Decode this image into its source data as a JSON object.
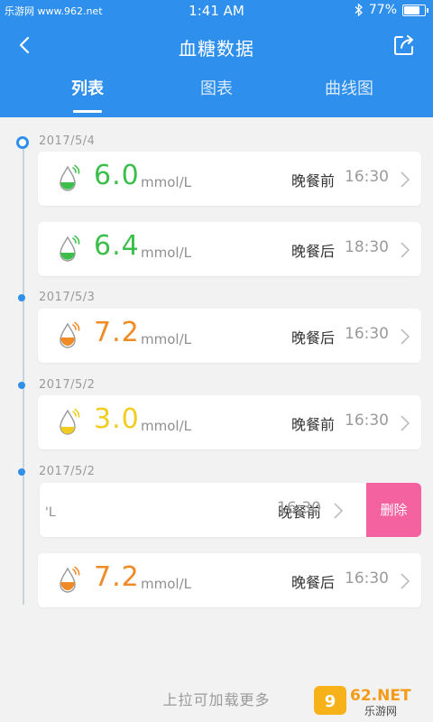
{
  "status": {
    "site": "乐游网 www.962.net",
    "time": "1:41 AM",
    "battery": "77%",
    "battery_level": 0.77
  },
  "header": {
    "title": "血糖数据",
    "tabs": [
      {
        "label": "列表",
        "active": true
      },
      {
        "label": "图表",
        "active": false
      },
      {
        "label": "曲线图",
        "active": false
      }
    ]
  },
  "groups": [
    {
      "date": "2017/5/4",
      "records": [
        {
          "value": "6.0",
          "unit": "mmol/L",
          "meal": "晚餐前",
          "time": "16:30",
          "color": "#3cbf4a",
          "level": "normal"
        },
        {
          "value": "6.4",
          "unit": "mmol/L",
          "meal": "晚餐后",
          "time": "18:30",
          "color": "#3cbf4a",
          "level": "normal"
        }
      ]
    },
    {
      "date": "2017/5/3",
      "records": [
        {
          "value": "7.2",
          "unit": "mmol/L",
          "meal": "晚餐后",
          "time": "16:30",
          "color": "#f08a24",
          "level": "high"
        }
      ]
    },
    {
      "date": "2017/5/2",
      "records": [
        {
          "value": "3.0",
          "unit": "mmol/L",
          "meal": "晚餐前",
          "time": "16:30",
          "color": "#f1cc21",
          "level": "low"
        }
      ]
    },
    {
      "date": "2017/5/2",
      "records": [
        {
          "value": "",
          "unit": "'L",
          "meal": "晚餐前",
          "time": "16:30",
          "swiped": true,
          "delete_label": "删除"
        },
        {
          "value": "7.2",
          "unit": "mmol/L",
          "meal": "晚餐后",
          "time": "16:30",
          "color": "#f08a24",
          "level": "high"
        }
      ]
    }
  ],
  "footer": {
    "load_more": "上拉可加载更多",
    "watermark_logo": "962.NET 乐游网"
  },
  "icons": {
    "back": "chevron-left-icon",
    "share": "share-icon",
    "glucose": "blood-drop-icon",
    "row_arrow": "chevron-right-icon"
  },
  "colors": {
    "primary": "#2e8fec",
    "normal": "#3cbf4a",
    "high": "#f08a24",
    "low": "#f1cc21",
    "delete": "#f462a0"
  }
}
